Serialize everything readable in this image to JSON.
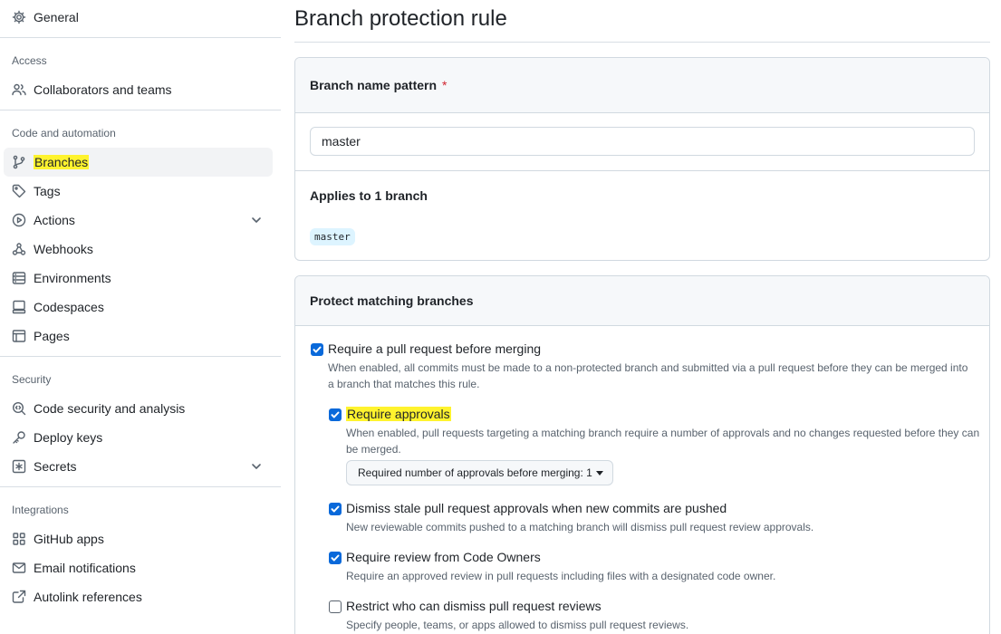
{
  "sidebar": {
    "general": "General",
    "groups": {
      "access": "Access",
      "code_automation": "Code and automation",
      "security": "Security",
      "integrations": "Integrations"
    },
    "items": {
      "collaborators": "Collaborators and teams",
      "branches": "Branches",
      "tags": "Tags",
      "actions": "Actions",
      "webhooks": "Webhooks",
      "environments": "Environments",
      "codespaces": "Codespaces",
      "pages": "Pages",
      "code_security": "Code security and analysis",
      "deploy_keys": "Deploy keys",
      "secrets": "Secrets",
      "github_apps": "GitHub apps",
      "email_notifications": "Email notifications",
      "autolink": "Autolink references"
    },
    "active_item": "Branches"
  },
  "main": {
    "title": "Branch protection rule",
    "pattern_box": {
      "header": "Branch name pattern",
      "required_mark": "*",
      "input_value": "master",
      "applies_text": "Applies to 1 branch",
      "branch_tag": "master"
    },
    "protect_box": {
      "header": "Protect matching branches",
      "options": [
        {
          "label": "Require a pull request before merging",
          "checked": true,
          "description": "When enabled, all commits must be made to a non-protected branch and submitted via a pull request before they can be merged into a branch that matches this rule."
        },
        {
          "label": "Require approvals",
          "checked": true,
          "description": "When enabled, pull requests targeting a matching branch require a number of approvals and no changes requested before they can be merged.",
          "select_label": "Required number of approvals before merging: 1"
        },
        {
          "label": "Dismiss stale pull request approvals when new commits are pushed",
          "checked": true,
          "description": "New reviewable commits pushed to a matching branch will dismiss pull request review approvals."
        },
        {
          "label": "Require review from Code Owners",
          "checked": true,
          "description": "Require an approved review in pull requests including files with a designated code owner."
        },
        {
          "label": "Restrict who can dismiss pull request reviews",
          "checked": false,
          "description": "Specify people, teams, or apps allowed to dismiss pull request reviews."
        }
      ]
    }
  },
  "colors": {
    "highlight": "#fff32e",
    "checkbox_blue": "#0969da",
    "required_red": "#d1242f"
  }
}
